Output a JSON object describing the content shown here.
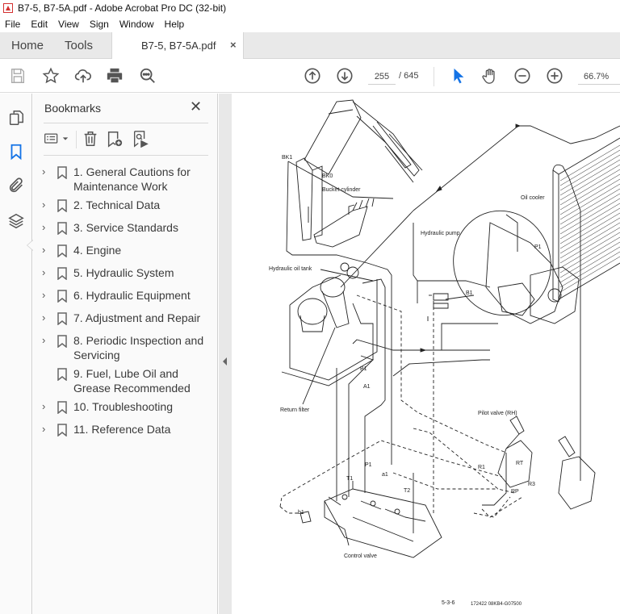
{
  "window": {
    "title": "B7-5, B7-5A.pdf - Adobe Acrobat Pro DC (32-bit)"
  },
  "menu": [
    "File",
    "Edit",
    "View",
    "Sign",
    "Window",
    "Help"
  ],
  "tabs": {
    "home": "Home",
    "tools": "Tools",
    "document": "B7-5, B7-5A.pdf",
    "close_glyph": "×"
  },
  "toolbar": {
    "current_page": "255",
    "total_pages": "/ 645",
    "zoom_level": "66.7%",
    "icons": [
      "save-icon",
      "bookmark-star-icon",
      "upload-cloud-icon",
      "print-icon",
      "search-zoom-icon",
      "page-up-icon",
      "page-down-icon",
      "select-cursor-icon",
      "hand-tool-icon",
      "zoom-out-icon",
      "zoom-in-icon"
    ],
    "accent_color": "#1473e6"
  },
  "rail": {
    "icons": [
      "page-thumbnails-icon",
      "bookmarks-icon",
      "attachments-icon",
      "layers-icon"
    ],
    "active": "bookmarks-icon"
  },
  "bookmarks": {
    "title": "Bookmarks",
    "close_glyph": "✕",
    "tools": [
      "options-menu-icon",
      "delete-bookmark-icon",
      "new-bookmark-icon",
      "find-bookmark-icon"
    ],
    "items": [
      {
        "label": "1. General Cautions for Maintenance Work",
        "expandable": true
      },
      {
        "label": "2. Technical Data",
        "expandable": true
      },
      {
        "label": "3. Service Standards",
        "expandable": true
      },
      {
        "label": "4. Engine",
        "expandable": true
      },
      {
        "label": "5. Hydraulic System",
        "expandable": true
      },
      {
        "label": "6. Hydraulic Equipment",
        "expandable": true
      },
      {
        "label": "7. Adjustment and Repair",
        "expandable": true
      },
      {
        "label": "8. Periodic Inspection and Servicing",
        "expandable": true
      },
      {
        "label": "9. Fuel, Lube Oil and Grease Recommended",
        "expandable": false
      },
      {
        "label": "10. Troubleshooting",
        "expandable": true
      },
      {
        "label": "11. Reference Data",
        "expandable": true
      }
    ]
  },
  "document_page": {
    "labels": {
      "bk1": "BK1",
      "bk0": "BK0",
      "bucket_cylinder": "Bucket cylinder",
      "oil_cooler": "Oil cooler",
      "hydraulic_pump": "Hydraulic pump",
      "p1_pump": "P1",
      "b1_pump": "B1",
      "hydraulic_oil_tank": "Hydraulic oil tank",
      "b1": "B1",
      "a1": "A1",
      "return_filter": "Return filter",
      "pilot_valve": "Pilot valve (RH)",
      "r1": "R1",
      "rt": "RT",
      "r3": "R3",
      "rp": "RP",
      "p1": "P1",
      "t1": "T1",
      "a1_valve": "a1",
      "t2": "T2",
      "b1_valve": "b1",
      "control_valve": "Control valve",
      "page_number": "5-3-6",
      "ref_code": "172422  08KB4-G07500"
    }
  }
}
